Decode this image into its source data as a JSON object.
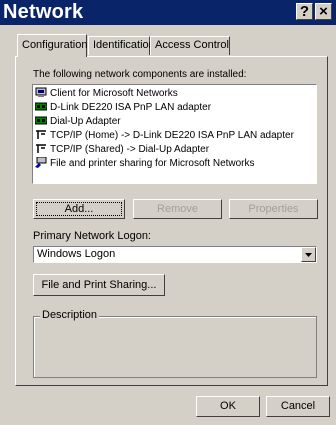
{
  "window": {
    "title": "Network",
    "help_glyph": "?",
    "close_glyph": "×"
  },
  "tabs": [
    {
      "label": "Configuration",
      "active": true
    },
    {
      "label": "Identification",
      "active": false
    },
    {
      "label": "Access Control",
      "active": false
    }
  ],
  "components": {
    "label": "The following network components are installed:",
    "items": [
      {
        "label": "Client for Microsoft Networks",
        "icon": "client-icon"
      },
      {
        "label": "D-Link DE220 ISA PnP LAN adapter",
        "icon": "adapter-icon"
      },
      {
        "label": "Dial-Up Adapter",
        "icon": "adapter-icon"
      },
      {
        "label": "TCP/IP (Home) -> D-Link DE220 ISA PnP LAN adapter",
        "icon": "protocol-icon"
      },
      {
        "label": "TCP/IP (Shared) -> Dial-Up Adapter",
        "icon": "protocol-icon"
      },
      {
        "label": "File and printer sharing for Microsoft Networks",
        "icon": "service-icon"
      }
    ]
  },
  "buttons": {
    "add": "Add...",
    "remove": "Remove",
    "properties": "Properties",
    "file_print_sharing": "File and Print Sharing...",
    "ok": "OK",
    "cancel": "Cancel"
  },
  "logon": {
    "label": "Primary Network Logon:",
    "value": "Windows Logon"
  },
  "description": {
    "label": "Description"
  },
  "colors": {
    "titlebar": "#0a246a",
    "face": "#d4d0c8"
  }
}
